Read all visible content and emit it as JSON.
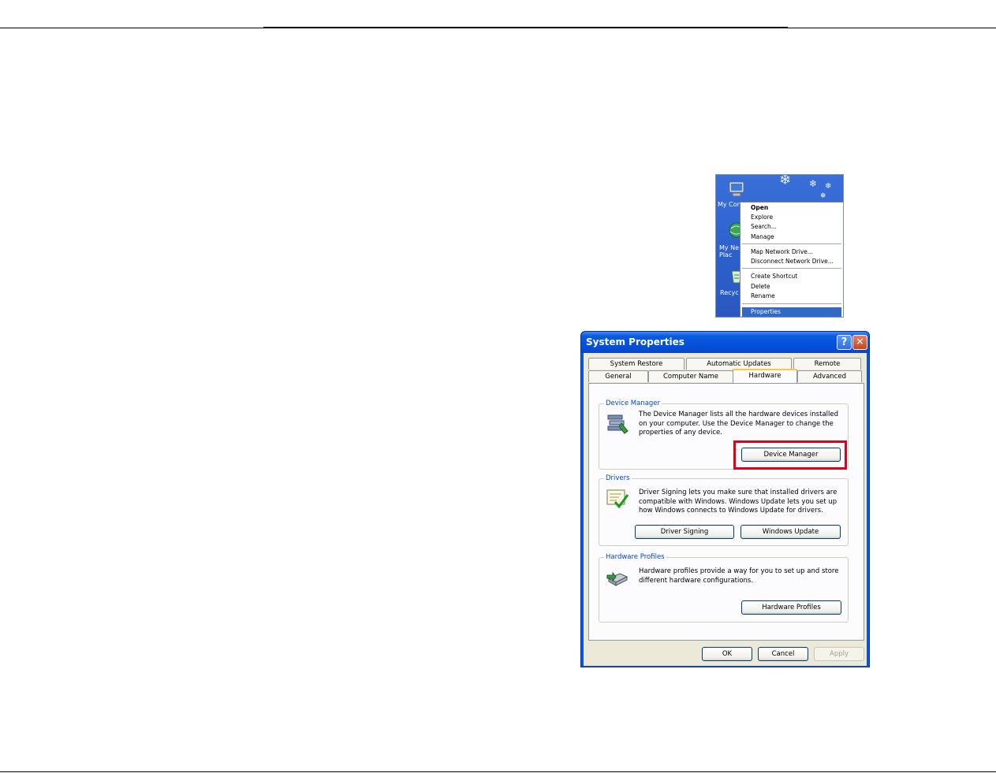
{
  "desktop": {
    "icons": [
      {
        "label": "My Com",
        "icon": "my-computer-icon"
      },
      {
        "label": "My Ne Plac",
        "icon": "network-places-icon"
      },
      {
        "label": "Recyc",
        "icon": "recycle-bin-icon"
      }
    ],
    "context_menu": {
      "items": [
        {
          "label": "Open",
          "bold": true
        },
        {
          "label": "Explore"
        },
        {
          "label": "Search..."
        },
        {
          "label": "Manage"
        },
        {
          "label": "Map Network Drive..."
        },
        {
          "label": "Disconnect Network Drive..."
        },
        {
          "label": "Create Shortcut"
        },
        {
          "label": "Delete"
        },
        {
          "label": "Rename"
        },
        {
          "label": "Properties",
          "selected": true
        }
      ]
    }
  },
  "dialog": {
    "title": "System Properties",
    "help_glyph": "?",
    "close_glyph": "✕",
    "tabs_row1": [
      "System Restore",
      "Automatic Updates",
      "Remote"
    ],
    "tabs_row2": [
      "General",
      "Computer Name",
      "Hardware",
      "Advanced"
    ],
    "active_tab": "Hardware",
    "device_manager": {
      "label": "Device Manager",
      "text": "The Device Manager lists all the hardware devices installed on your computer. Use the Device Manager to change the properties of any device.",
      "button": "Device Manager"
    },
    "drivers": {
      "label": "Drivers",
      "text": "Driver Signing lets you make sure that installed drivers are compatible with Windows. Windows Update lets you set up how Windows connects to Windows Update for drivers.",
      "button_signing": "Driver Signing",
      "button_update": "Windows Update"
    },
    "hardware_profiles": {
      "label": "Hardware Profiles",
      "text": "Hardware profiles provide a way for you to set up and store different hardware configurations.",
      "button": "Hardware Profiles"
    },
    "footer": {
      "ok": "OK",
      "cancel": "Cancel",
      "apply": "Apply"
    }
  },
  "colors": {
    "highlight_box": "#e0001b",
    "menu_selected": "#316ac5",
    "group_label": "#0046d5"
  }
}
